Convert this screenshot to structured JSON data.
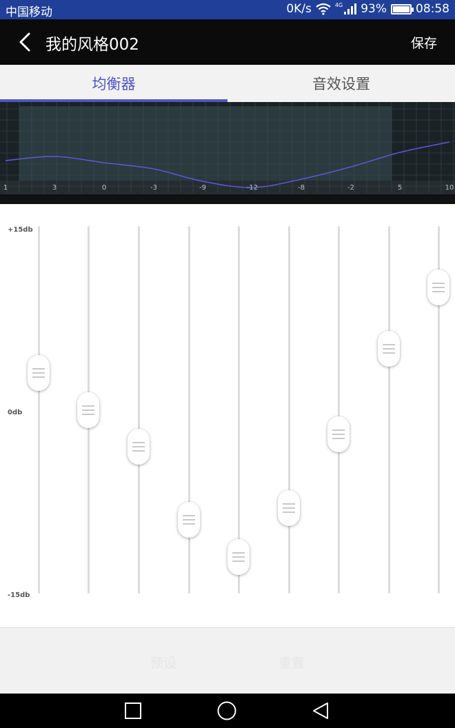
{
  "status_bar": {
    "carrier": "中国移动",
    "speed": "0K/s",
    "network": "4G",
    "battery": "93%",
    "battery_level": 0.93,
    "time": "08:58"
  },
  "action_bar": {
    "title": "我的风格002",
    "save_label": "保存"
  },
  "tabs": [
    {
      "label": "均衡器",
      "active": true
    },
    {
      "label": "音效设置",
      "active": false
    }
  ],
  "graph": {
    "tick_labels": [
      "1",
      "3",
      "0",
      "-3",
      "-9",
      "-12",
      "-8",
      "-2",
      "5",
      "10"
    ],
    "curve_color": "#5b57d6"
  },
  "equalizer": {
    "max_label": "+15db",
    "zero_label": "0db",
    "min_label": "-15db",
    "range": [
      -15,
      15
    ],
    "band_values": [
      1,
      3,
      0,
      -3,
      -9,
      -12,
      -8,
      -2,
      5,
      10
    ]
  },
  "bottom": {
    "preset_label": "预设",
    "reset_label": "重置"
  },
  "colors": {
    "accent": "#4f54c8",
    "status_bar": "#1f3f99",
    "action_bar": "#0b0b0b"
  }
}
